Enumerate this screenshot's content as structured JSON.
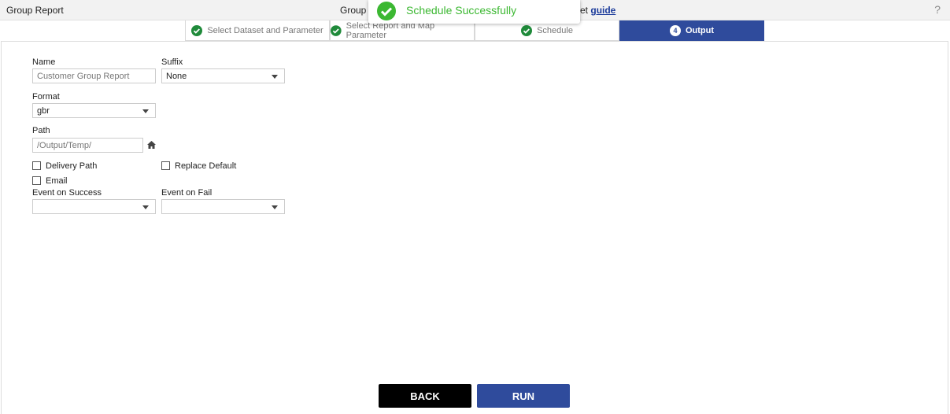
{
  "header": {
    "title": "Group Report",
    "center_text_partial": "Group r",
    "right_text_partial": "et",
    "guide_link": "guide",
    "help": "?"
  },
  "toast": {
    "message": "Schedule Successfully",
    "color": "#3cb832"
  },
  "steps": [
    {
      "label": "Select Dataset and Parameter",
      "status": "done"
    },
    {
      "label": "Select Report and Map Parameter",
      "status": "done"
    },
    {
      "label": "Schedule",
      "status": "done"
    },
    {
      "label": "Output",
      "number": "4",
      "status": "active"
    }
  ],
  "form": {
    "name_label": "Name",
    "name_value": "Customer Group Report",
    "suffix_label": "Suffix",
    "suffix_value": "None",
    "format_label": "Format",
    "format_value": "gbr",
    "path_label": "Path",
    "path_value": "/Output/Temp/",
    "delivery_path": "Delivery Path",
    "replace_default": "Replace Default",
    "email": "Email",
    "event_success_label": "Event on Success",
    "event_fail_label": "Event on Fail"
  },
  "buttons": {
    "back": "BACK",
    "run": "RUN"
  },
  "colors": {
    "accent": "#2f4b9c",
    "check": "#1f8a3a"
  }
}
